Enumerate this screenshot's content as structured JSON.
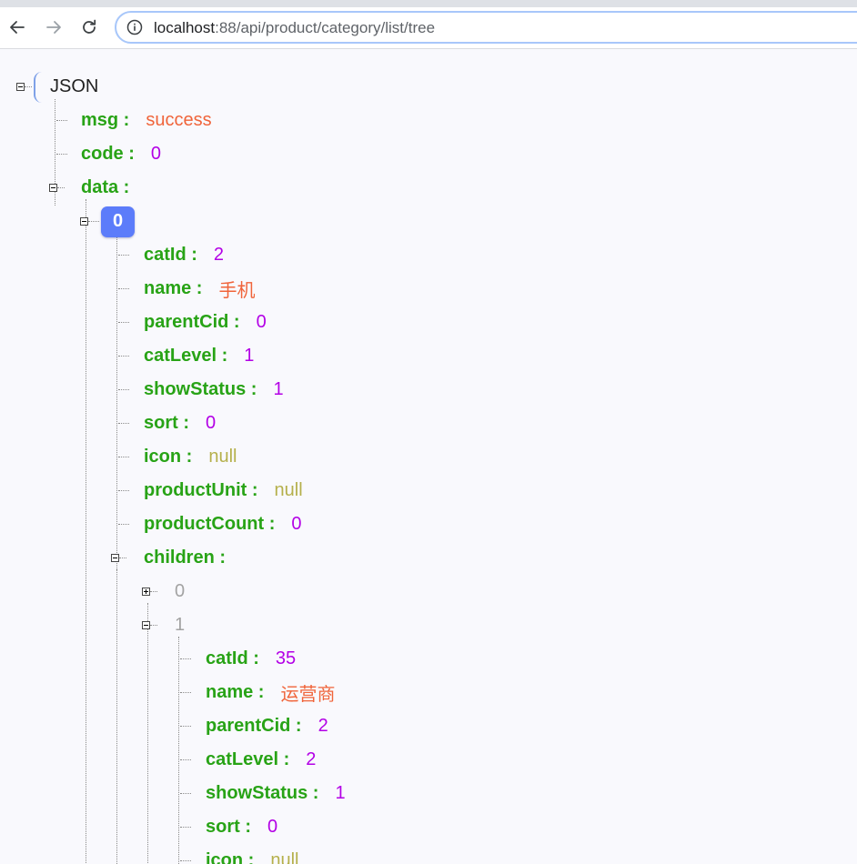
{
  "browser": {
    "url_host": "localhost",
    "url_rest": ":88/api/product/category/list/tree"
  },
  "json_tree": {
    "root_label": "JSON",
    "msg": {
      "key": "msg :",
      "value": "success"
    },
    "code": {
      "key": "code :",
      "value": "0"
    },
    "data": {
      "key": "data :"
    },
    "item0": {
      "index": "0",
      "catId": {
        "key": "catId :",
        "value": "2"
      },
      "name": {
        "key": "name :",
        "value": "手机"
      },
      "parentCid": {
        "key": "parentCid :",
        "value": "0"
      },
      "catLevel": {
        "key": "catLevel :",
        "value": "1"
      },
      "showStatus": {
        "key": "showStatus :",
        "value": "1"
      },
      "sort": {
        "key": "sort :",
        "value": "0"
      },
      "icon": {
        "key": "icon :",
        "value": "null"
      },
      "productUnit": {
        "key": "productUnit :",
        "value": "null"
      },
      "productCount": {
        "key": "productCount :",
        "value": "0"
      },
      "children": {
        "key": "children :"
      }
    },
    "child0": {
      "index": "0"
    },
    "child1": {
      "index": "1",
      "catId": {
        "key": "catId :",
        "value": "35"
      },
      "name": {
        "key": "name :",
        "value": "运营商"
      },
      "parentCid": {
        "key": "parentCid :",
        "value": "2"
      },
      "catLevel": {
        "key": "catLevel :",
        "value": "2"
      },
      "showStatus": {
        "key": "showStatus :",
        "value": "1"
      },
      "sort": {
        "key": "sort :",
        "value": "0"
      },
      "icon": {
        "key": "icon :",
        "value": "null"
      }
    }
  }
}
